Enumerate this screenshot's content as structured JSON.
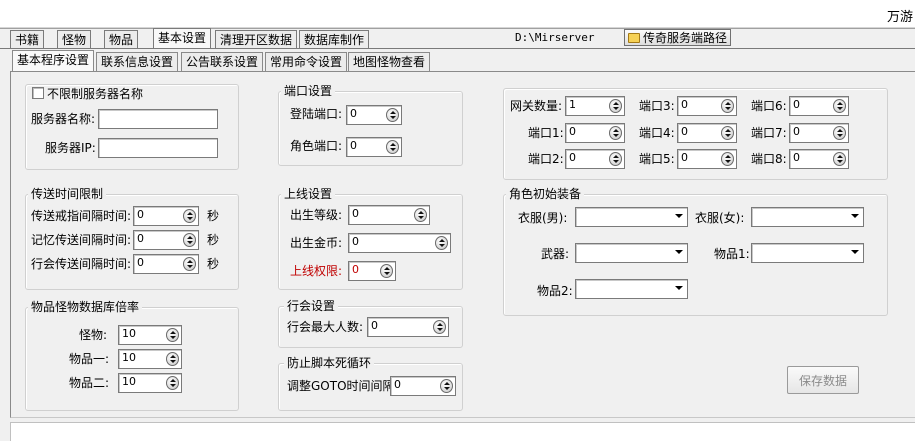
{
  "window": {
    "title": "万游"
  },
  "main_tabs": [
    "书籍",
    "怪物",
    "物品",
    "基本设置",
    "清理开区数据",
    "数据库制作"
  ],
  "server_path": {
    "value": "D:\\Mirserver",
    "button_label": "传奇服务端路径"
  },
  "sub_tabs": [
    "基本程序设置",
    "联系信息设置",
    "公告联系设置",
    "常用命令设置",
    "地图怪物查看"
  ],
  "server_info": {
    "unlimited_name_label": "不限制服务器名称",
    "name_label": "服务器名称:",
    "name_value": "",
    "ip_label": "服务器IP:",
    "ip_value": ""
  },
  "ports": {
    "title": "端口设置",
    "login_label": "登陆端口:",
    "login_value": "0",
    "role_label": "角色端口:",
    "role_value": "0"
  },
  "gateway": {
    "count_label": "网关数量:",
    "count_value": "1",
    "ports": [
      {
        "label": "端口1:",
        "value": "0"
      },
      {
        "label": "端口2:",
        "value": "0"
      },
      {
        "label": "端口3:",
        "value": "0"
      },
      {
        "label": "端口4:",
        "value": "0"
      },
      {
        "label": "端口5:",
        "value": "0"
      },
      {
        "label": "端口6:",
        "value": "0"
      },
      {
        "label": "端口7:",
        "value": "0"
      },
      {
        "label": "端口8:",
        "value": "0"
      }
    ]
  },
  "teleport": {
    "title": "传送时间限制",
    "unit": "秒",
    "rows": [
      {
        "label": "传送戒指间隔时间:",
        "value": "0"
      },
      {
        "label": "记忆传送间隔时间:",
        "value": "0"
      },
      {
        "label": "行会传送间隔时间:",
        "value": "0"
      }
    ]
  },
  "login_settings": {
    "title": "上线设置",
    "birth_level_label": "出生等级:",
    "birth_level_value": "0",
    "birth_gold_label": "出生金币:",
    "birth_gold_value": "0",
    "login_perm_label": "上线权限:",
    "login_perm_value": "0"
  },
  "equipment": {
    "title": "角色初始装备",
    "clothes_m_label": "衣服(男):",
    "clothes_f_label": "衣服(女):",
    "weapon_label": "武器:",
    "item1_label": "物品1:",
    "item2_label": "物品2:",
    "clothes_m_value": "",
    "clothes_f_value": "",
    "weapon_value": "",
    "item1_value": "",
    "item2_value": ""
  },
  "rates": {
    "title": "物品怪物数据库倍率",
    "monster_label": "怪物:",
    "monster_value": "10",
    "item1_label": "物品一:",
    "item1_value": "10",
    "item2_label": "物品二:",
    "item2_value": "10"
  },
  "guild": {
    "title": "行会设置",
    "max_label": "行会最大人数:",
    "max_value": "0"
  },
  "anti_loop": {
    "title": "防止脚本死循环",
    "goto_label": "调整GOTO时间间隔:",
    "goto_value": "0"
  },
  "save_button": "保存数据",
  "colors": {
    "permission_label": "#c00000",
    "window_bg": "#f0f0f0"
  }
}
